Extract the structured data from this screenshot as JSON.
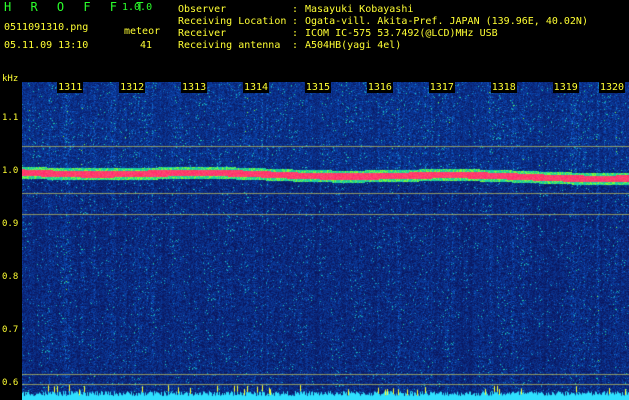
{
  "header": {
    "app_title": "H R O F F T",
    "app_version": "1.0.0",
    "file_name": "0511091310.png",
    "date_time": "05.11.09 13:10",
    "meteor_label": "meteor",
    "meteor_count": "41"
  },
  "info": [
    {
      "label": "Observer",
      "value": "Masayuki Kobayashi"
    },
    {
      "label": "Receiving Location",
      "value": "Ogata-vill. Akita-Pref. JAPAN (139.96E, 40.02N)"
    },
    {
      "label": "Receiver",
      "value": "ICOM IC-575 53.7492(@LCD)MHz USB"
    },
    {
      "label": "Receiving antenna",
      "value": "A504HB(yagi 4el)"
    }
  ],
  "info_separator": ":",
  "colors": {
    "title_green": "#2bff2b",
    "text_yellow": "#ffff33",
    "background": "#000000",
    "noise_blue": "#1e3c9c",
    "signal_red": "#ff2a5a"
  },
  "spectrogram": {
    "y_unit_label": "kHz",
    "y_ticks": [
      "1.1",
      "1.0",
      "0.9",
      "0.8",
      "0.7",
      "0.6"
    ],
    "y_tick_values": [
      1.1,
      1.0,
      0.9,
      0.8,
      0.7,
      0.6
    ],
    "y_range": [
      0.57,
      1.17
    ],
    "x_ticks": [
      "1311",
      "1312",
      "1313",
      "1314",
      "1315",
      "1316",
      "1317",
      "1318",
      "1319",
      "1320"
    ],
    "x_tick_values": [
      1311,
      1312,
      1313,
      1314,
      1315,
      1316,
      1317,
      1318,
      1319,
      1320
    ],
    "x_range": [
      1310.4,
      1320.2
    ],
    "carrier_start_khz": 1.0,
    "carrier_end_khz": 0.99,
    "auxiliary_lines_khz": [
      1.05,
      0.96,
      0.92,
      0.62,
      0.6
    ]
  }
}
